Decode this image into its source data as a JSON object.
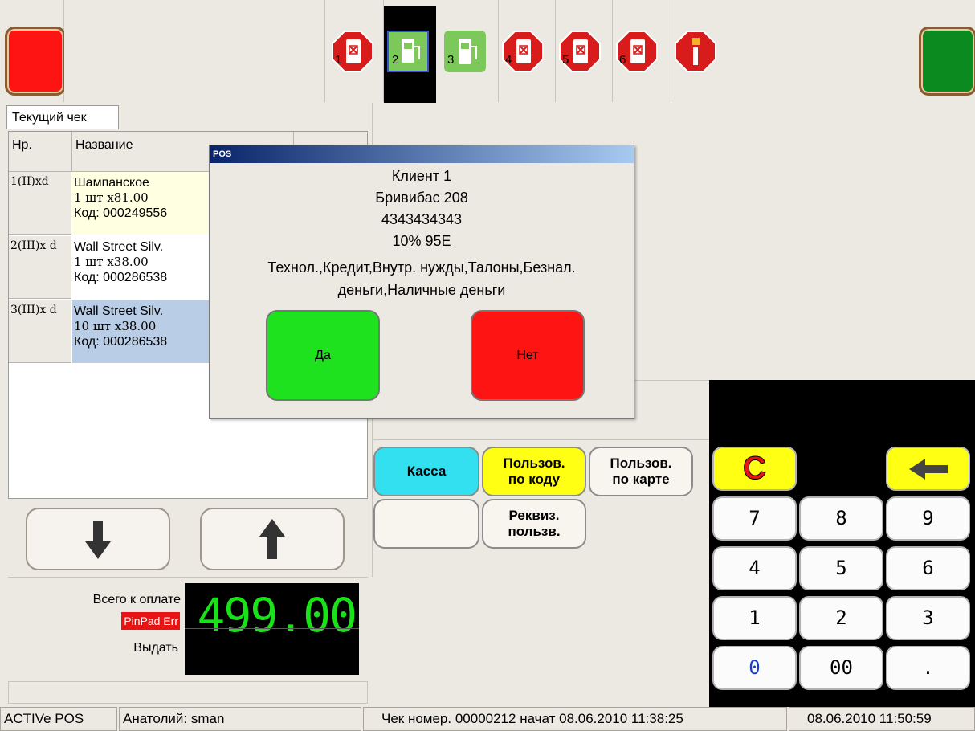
{
  "pumps": [
    {
      "number": "1",
      "state": "blocked"
    },
    {
      "number": "2",
      "state": "selected-available"
    },
    {
      "number": "3",
      "state": "available"
    },
    {
      "number": "4",
      "state": "blocked"
    },
    {
      "number": "5",
      "state": "blocked"
    },
    {
      "number": "6",
      "state": "blocked"
    }
  ],
  "receipt": {
    "tab_label": "Текущий чек",
    "col_nr": "Нр.",
    "col_name": "Название",
    "items": [
      {
        "nr": "1(II)xd",
        "name": "Шампанское",
        "qty": "1 шт x81.00",
        "code": "Код: 000249556"
      },
      {
        "nr": "2(III)x d",
        "name": "Wall Street Silv.",
        "qty": "1 шт x38.00",
        "code": "Код: 000286538"
      },
      {
        "nr": "3(III)x d",
        "name": "Wall Street Silv.",
        "qty": "10 шт x38.00",
        "code": "Код: 000286538"
      }
    ]
  },
  "totals": {
    "total_label": "Всего к оплате",
    "total_value": "499.00",
    "pinpad_error": "PinPad Err",
    "change_label": "Выдать"
  },
  "dialog": {
    "title": "POS",
    "lines": [
      "Клиент 1",
      "Бривибас 208",
      "4343434343",
      "10% 95E",
      "Технол.,Кредит,Внутр. нужды,Талоны,Безнал.",
      "деньги,Наличные деньги"
    ],
    "yes_label": "Да",
    "no_label": "Нет"
  },
  "actions": {
    "kassa": "Касса",
    "user_by_code_1": "Пользов.",
    "user_by_code_2": "по коду",
    "user_by_card_1": "Пользов.",
    "user_by_card_2": "по карте",
    "user_details_1": "Реквиз.",
    "user_details_2": "пользв."
  },
  "keypad": {
    "clear": "C",
    "keys": [
      "7",
      "8",
      "9",
      "4",
      "5",
      "6",
      "1",
      "2",
      "3",
      "0",
      "00",
      "."
    ]
  },
  "status": {
    "app": "ACTIVe POS",
    "user": "Анатолий: sman",
    "receipt_info": "Чек номер. 00000212 начат 08.06.2010 11:38:25",
    "datetime": "08.06.2010 11:50:59"
  },
  "colors": {
    "background": "#ece9e2",
    "green_button": "#1fe21f",
    "red_button": "#ff1414",
    "cyan_button": "#33e0f0",
    "yellow_button": "#ffff14",
    "selected_row": "#b9cde6",
    "first_row": "#ffffe2",
    "display_green": "#19e219"
  }
}
